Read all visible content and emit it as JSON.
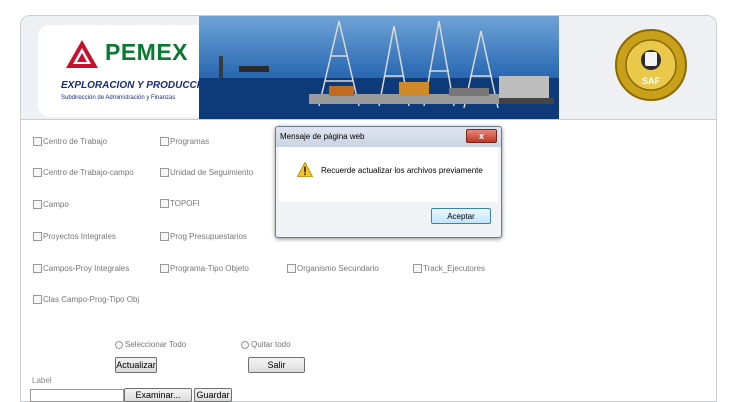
{
  "header": {
    "brand": "PEMEX",
    "division": "EXPLORACION Y PRODUCCION",
    "subdivision": "Subdirección de Administración y Finanzas",
    "seal_label": "SAF",
    "colors": {
      "brand_green": "#0a7a2e",
      "brand_red": "#c8102e",
      "navy": "#1a2d78"
    }
  },
  "checkboxes": [
    {
      "label": "Centro de Trabajo",
      "checked": false
    },
    {
      "label": "Programas",
      "checked": false
    },
    {
      "label": "Centro de Trabajo-campo",
      "checked": false
    },
    {
      "label": "Unidad de Seguimiento",
      "checked": false
    },
    {
      "label": "Campo",
      "checked": false
    },
    {
      "label": "TOPOFI",
      "checked": false
    },
    {
      "label": "Proyectos Integrales",
      "checked": false
    },
    {
      "label": "Prog Presupuestarios",
      "checked": false
    },
    {
      "label": "Campos-Proy Integrales",
      "checked": false
    },
    {
      "label": "Programa-Tipo Objeto",
      "checked": false
    },
    {
      "label": "Organismo Secundario",
      "checked": false
    },
    {
      "label": "Track_Ejecutores",
      "checked": false
    },
    {
      "label": "Clas Campo-Prog-Tipo Obj",
      "checked": false
    }
  ],
  "selection": {
    "select_all": "Seleccionar Todo",
    "clear_all": "Quitar todo"
  },
  "actions": {
    "update": "Actualizar",
    "exit": "Salir",
    "label": "Label",
    "browse": "Examinar...",
    "save": "Guardar"
  },
  "dialog": {
    "title": "Mensaje de página web",
    "message": "Recuerde actualizar los archivos previamente",
    "ok": "Aceptar",
    "close_glyph": "x"
  }
}
